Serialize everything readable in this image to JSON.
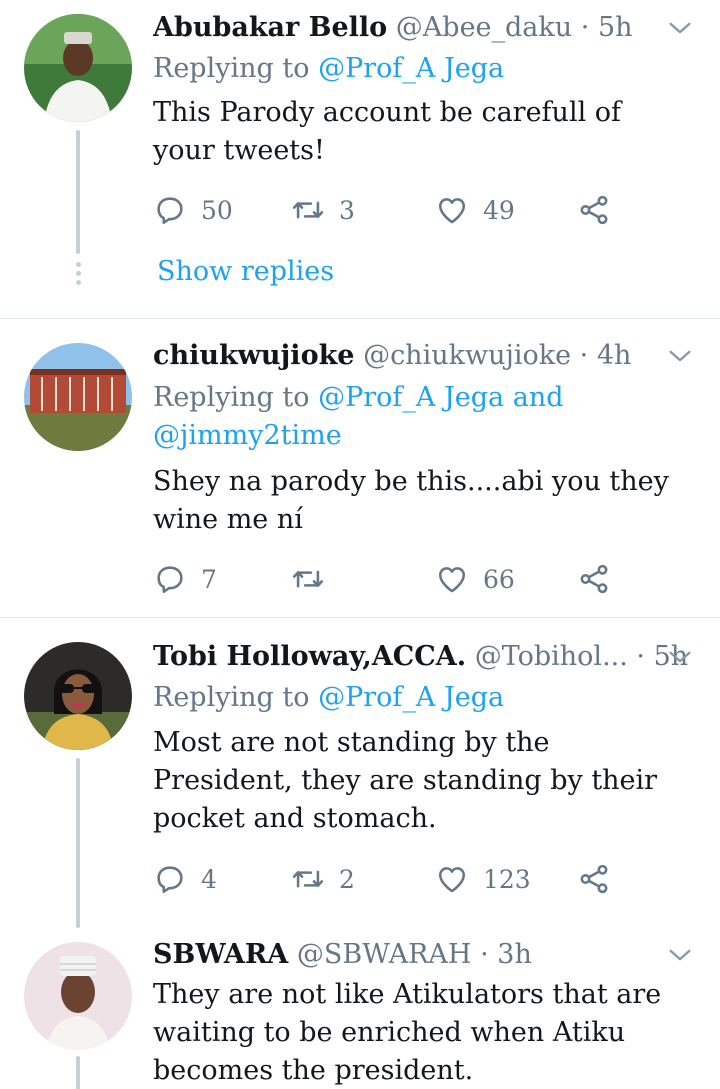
{
  "tweets": [
    {
      "name": "Abubakar Bello",
      "handle": "@Abee_daku",
      "dot": "·",
      "time": "5h",
      "replying_prefix": "Replying to ",
      "mentions": "@Prof_A Jega",
      "text": "This Parody account be carefull of your tweets!",
      "replies": "50",
      "retweets": "3",
      "likes": "49",
      "show_replies": "Show replies"
    },
    {
      "name": "chiukwujioke",
      "handle": "@chiukwujioke",
      "dot": "·",
      "time": "4h",
      "replying_prefix": "Replying to ",
      "mentions": "@Prof_A Jega and @jimmy2time",
      "text": "Shey na parody be this....abi you they wine me ní",
      "replies": "7",
      "retweets": "",
      "likes": "66"
    },
    {
      "name": "Tobi Holloway,ACCA.",
      "handle": "@Tobihol...",
      "dot": "·",
      "time": "5h",
      "replying_prefix": "Replying to ",
      "mentions": "@Prof_A Jega",
      "text": "Most are not standing by the President, they are standing by their pocket and stomach.",
      "replies": "4",
      "retweets": "2",
      "likes": "123"
    },
    {
      "name": "SBWARA",
      "handle": "@SBWARAH",
      "dot": "·",
      "time": "3h",
      "text": "They are not like Atikulators that are waiting to be enriched when Atiku becomes the president."
    }
  ],
  "icons": {
    "reply": "reply-icon",
    "retweet": "retweet-icon",
    "like": "heart-icon",
    "share": "share-icon",
    "more": "chevron-down-icon"
  },
  "colors": {
    "link": "#1da1f2",
    "muted": "#657786",
    "thread_line": "#c4cfd6",
    "divider": "#e1e8ed"
  }
}
